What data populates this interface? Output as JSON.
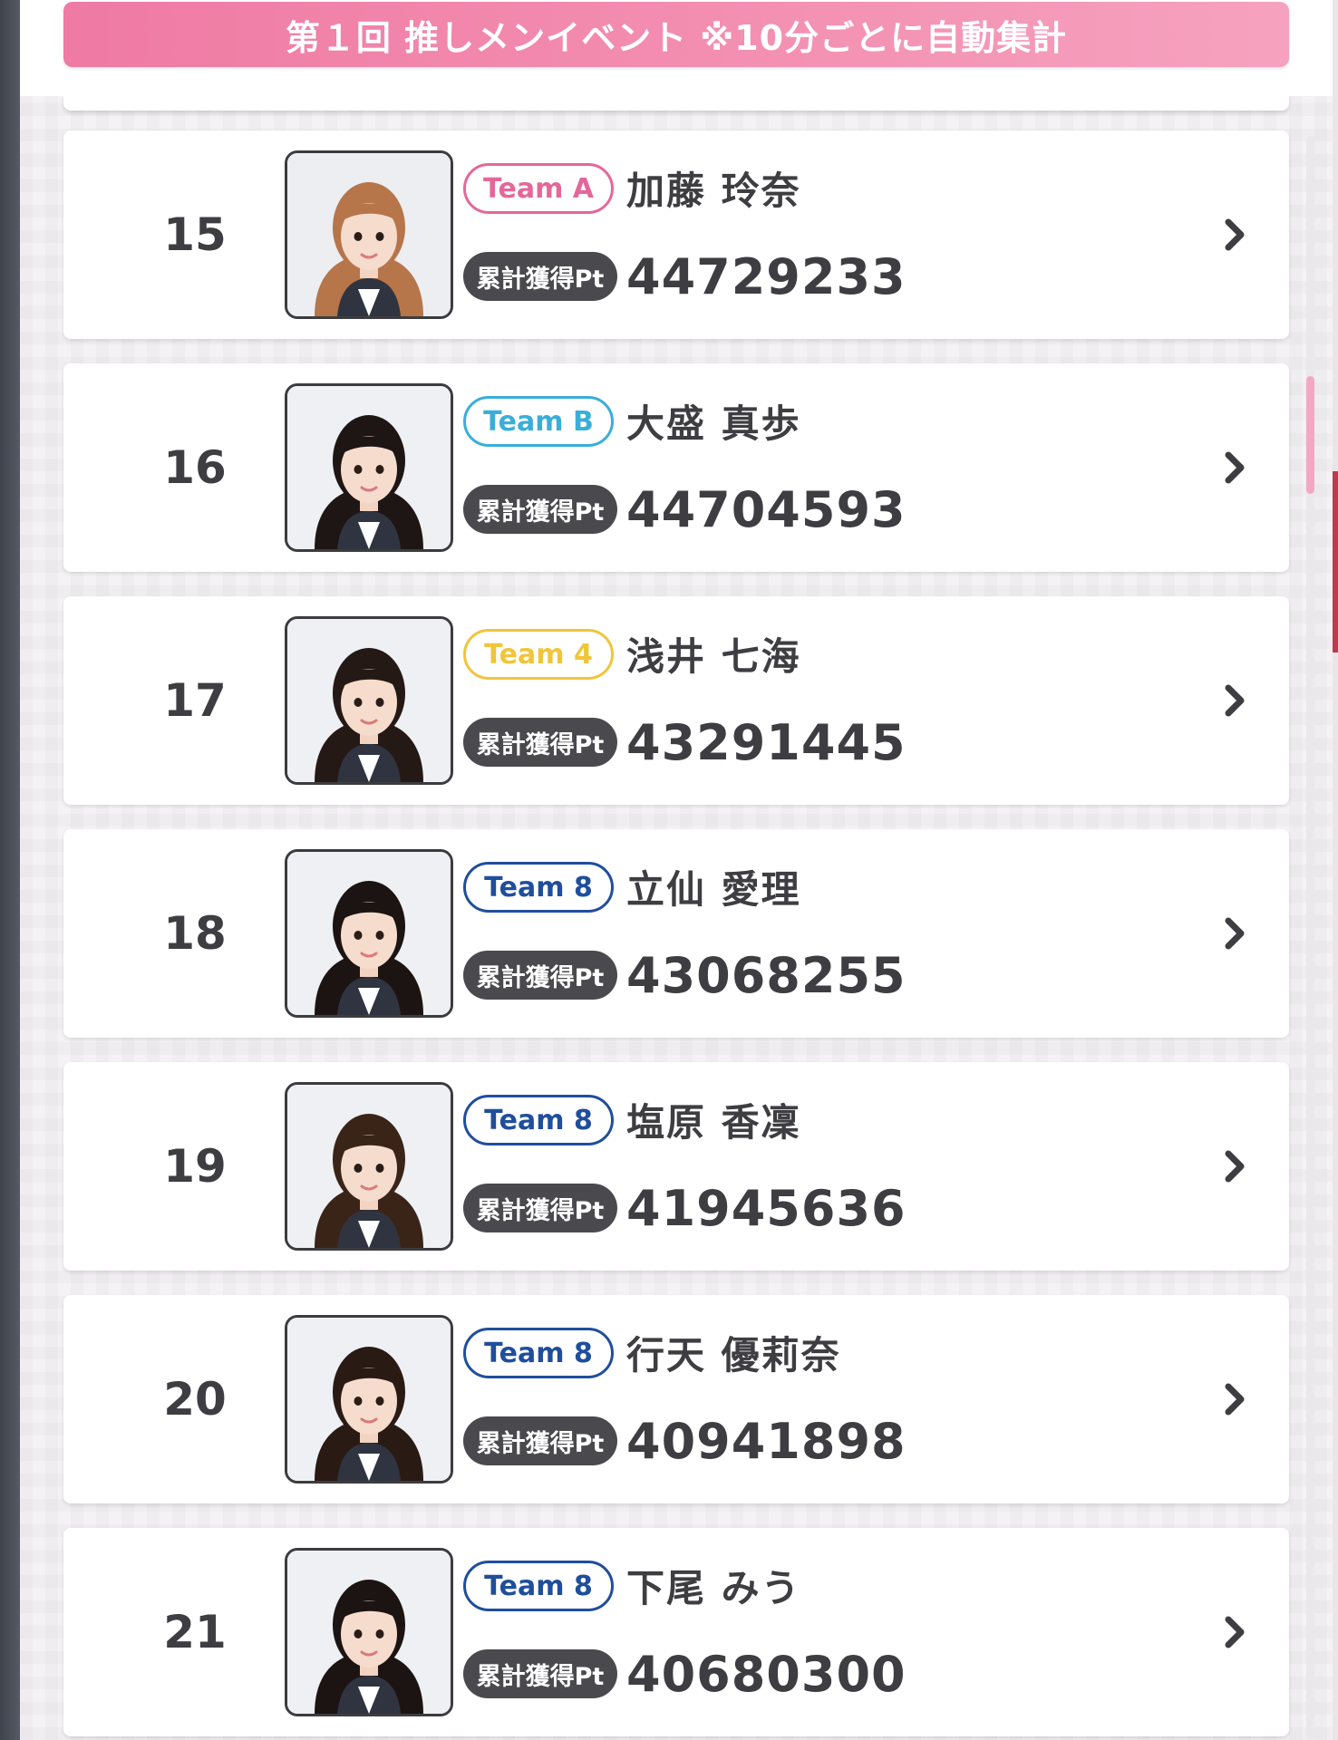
{
  "header": {
    "banner_text": "第１回 推しメンイベント ※10分ごとに自動集計"
  },
  "colors": {
    "banner_pink": "#f38db0",
    "team_a": "#e5679a",
    "team_b": "#3aaed8",
    "team_4": "#f0c53a",
    "team_8": "#1f4e9c",
    "points_label_bg": "#4a4a4e",
    "scroll_thumb": "#f2a8c2"
  },
  "ranking": [
    {
      "rank": "15",
      "team": "Team A",
      "team_color": "#e5679a",
      "name": "加藤 玲奈",
      "points_label": "累計獲得Pt",
      "points": "44729233",
      "hair": "#b6764a",
      "bg": "#eceef2"
    },
    {
      "rank": "16",
      "team": "Team B",
      "team_color": "#3aaed8",
      "name": "大盛 真歩",
      "points_label": "累計獲得Pt",
      "points": "44704593",
      "hair": "#1e1614",
      "bg": "#eef0f3"
    },
    {
      "rank": "17",
      "team": "Team 4",
      "team_color": "#f0c53a",
      "name": "浅井 七海",
      "points_label": "累計獲得Pt",
      "points": "43291445",
      "hair": "#241915",
      "bg": "#eef0f3"
    },
    {
      "rank": "18",
      "team": "Team 8",
      "team_color": "#1f4e9c",
      "name": "立仙 愛理",
      "points_label": "累計獲得Pt",
      "points": "43068255",
      "hair": "#1c1412",
      "bg": "#eef0f3"
    },
    {
      "rank": "19",
      "team": "Team 8",
      "team_color": "#1f4e9c",
      "name": "塩原 香凜",
      "points_label": "累計獲得Pt",
      "points": "41945636",
      "hair": "#3a2418",
      "bg": "#eef0f3"
    },
    {
      "rank": "20",
      "team": "Team 8",
      "team_color": "#1f4e9c",
      "name": "行天 優莉奈",
      "points_label": "累計獲得Pt",
      "points": "40941898",
      "hair": "#2a1a14",
      "bg": "#eef0f3"
    },
    {
      "rank": "21",
      "team": "Team 8",
      "team_color": "#1f4e9c",
      "name": "下尾 みう",
      "points_label": "累計獲得Pt",
      "points": "40680300",
      "hair": "#1c1412",
      "bg": "#eef0f3"
    }
  ]
}
